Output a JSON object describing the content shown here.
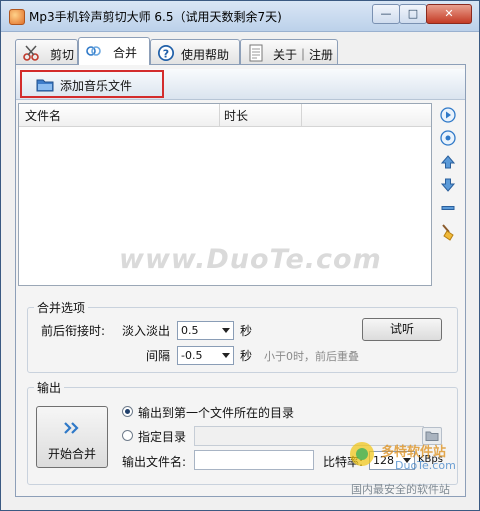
{
  "window": {
    "title": "Mp3手机铃声剪切大师 6.5（试用天数剩余7天)",
    "min": "—",
    "max": "□",
    "close": "✕"
  },
  "tabs": [
    {
      "label": "剪切",
      "icon": "scissors-icon"
    },
    {
      "label": "合并",
      "icon": "merge-icon"
    },
    {
      "label": "使用帮助",
      "icon": "help-icon"
    },
    {
      "label": "关于｜注册",
      "icon": "document-icon"
    }
  ],
  "active_tab": 1,
  "toolbar": {
    "add_label": "添加音乐文件",
    "icon": "folder-icon"
  },
  "filelist": {
    "columns": [
      "文件名",
      "时长"
    ],
    "rows": []
  },
  "side_tools": [
    "play-icon",
    "stop-icon",
    "move-up-icon",
    "move-down-icon",
    "remove-icon",
    "clear-broom-icon"
  ],
  "watermark": "www.DuoTe.com",
  "merge_options": {
    "title": "合并选项",
    "join_label": "前后衔接时:",
    "fade_label": "淡入淡出",
    "fade_value": "0.5",
    "fade_unit": "秒",
    "gap_label": "间隔",
    "gap_value": "-0.5",
    "gap_unit": "秒",
    "gap_hint": "小于0时，前后重叠",
    "listen_button": "试听"
  },
  "output": {
    "title": "输出",
    "start_button": "开始合并",
    "start_icon": "double-chevron-icon",
    "option_first_dir": "输出到第一个文件所在的目录",
    "option_first_selected": true,
    "option_custom_dir": "指定目录",
    "option_custom_selected": false,
    "custom_dir_value": "",
    "filename_label": "输出文件名:",
    "filename_value": "",
    "bitrate_label": "比特率:",
    "bitrate_value": "128",
    "bitrate_unit": "KBps"
  },
  "site_badge": {
    "brand": "多特软件站",
    "url": "DuoTe.com",
    "slogan": "国内最安全的软件站"
  },
  "colors": {
    "accent_red": "#d32c2c",
    "tool_blue": "#2f79c8",
    "window_border": "#3b5a82"
  }
}
